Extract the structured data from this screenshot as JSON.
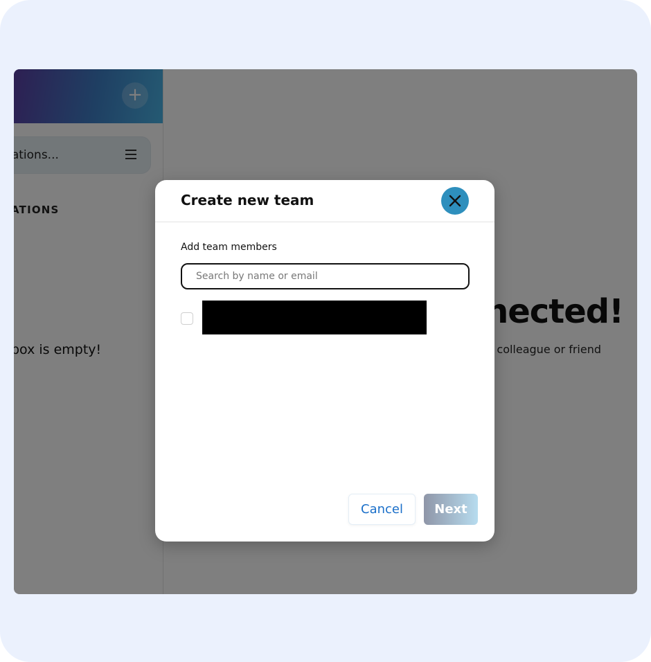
{
  "sidebar": {
    "new_chat_label": "+",
    "search_text": "rsations...",
    "conversations_heading": "ATIONS",
    "empty_message": "box is empty!"
  },
  "main": {
    "headline": "nnected!",
    "hint": "a colleague or friend"
  },
  "modal": {
    "title": "Create new team",
    "section_label": "Add team members",
    "search_placeholder": "Search by name or email",
    "cancel_label": "Cancel",
    "next_label": "Next",
    "members": [
      {
        "checked": false,
        "name_redacted": true
      }
    ]
  },
  "icons": {
    "close": "close-icon",
    "menu": "menu-icon",
    "plus": "plus-icon"
  },
  "colors": {
    "accent": "#2e8fbd",
    "cancel_text": "#1a6fc9",
    "outer_background": "#ebf1fd"
  }
}
